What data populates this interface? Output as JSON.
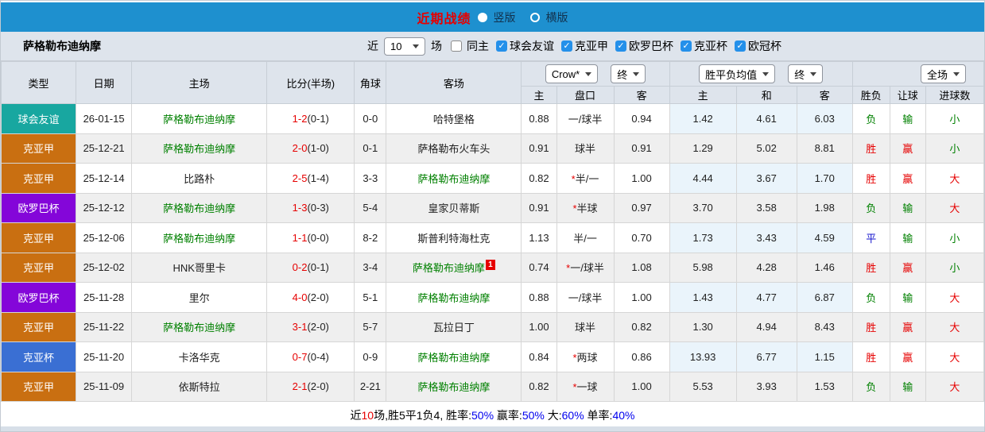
{
  "titlebar": {
    "title": "近期战绩",
    "vertical_label": "竖版",
    "vertical_selected": true,
    "horizontal_label": "横版",
    "horizontal_selected": false
  },
  "filterbar": {
    "team_name": "萨格勒布迪纳摩",
    "near_label": "近",
    "near_value": "10",
    "games_label": "场",
    "same_home_label": "同主",
    "same_home_checked": false,
    "leagues": [
      {
        "label": "球会友谊",
        "checked": true
      },
      {
        "label": "克亚甲",
        "checked": true
      },
      {
        "label": "欧罗巴杯",
        "checked": true
      },
      {
        "label": "克亚杯",
        "checked": true
      },
      {
        "label": "欧冠杯",
        "checked": true
      }
    ]
  },
  "table": {
    "columns_main": [
      "类型",
      "日期",
      "主场",
      "比分(半场)",
      "角球",
      "客场"
    ],
    "columns_sub": [
      "主",
      "盘口",
      "客",
      "主",
      "和",
      "客",
      "胜负",
      "让球",
      "进球数"
    ],
    "selects": {
      "odds_source": "Crow*",
      "odds_time": "终",
      "avg_metric": "胜平负均值",
      "avg_time": "终",
      "scope": "全场"
    },
    "rows": [
      {
        "type": "球会友谊",
        "type_color": "teal",
        "date": "26-01-15",
        "home": "萨格勒布迪纳摩",
        "home_color": "green",
        "score": "1-2",
        "half": "(0-1)",
        "corner": "0-0",
        "away": "哈特堡格",
        "away_color": "",
        "away_red_card": "",
        "odds_home": "0.88",
        "handicap_star": "",
        "handicap": "一/球半",
        "odds_away": "0.94",
        "avg_home": "1.42",
        "avg_draw": "4.61",
        "avg_away": "6.03",
        "result": "负",
        "result_color": "green",
        "handicap_result": "输",
        "handicap_result_color": "green",
        "goals": "小",
        "goals_color": "green"
      },
      {
        "type": "克亚甲",
        "type_color": "orange",
        "date": "25-12-21",
        "home": "萨格勒布迪纳摩",
        "home_color": "green",
        "score": "2-0",
        "half": "(1-0)",
        "corner": "0-1",
        "away": "萨格勒布火车头",
        "away_color": "",
        "away_red_card": "",
        "odds_home": "0.91",
        "handicap_star": "",
        "handicap": "球半",
        "odds_away": "0.91",
        "avg_home": "1.29",
        "avg_draw": "5.02",
        "avg_away": "8.81",
        "result": "胜",
        "result_color": "red",
        "handicap_result": "赢",
        "handicap_result_color": "red",
        "goals": "小",
        "goals_color": "green"
      },
      {
        "type": "克亚甲",
        "type_color": "orange",
        "date": "25-12-14",
        "home": "比路朴",
        "home_color": "",
        "score": "2-5",
        "half": "(1-4)",
        "corner": "3-3",
        "away": "萨格勒布迪纳摩",
        "away_color": "green",
        "away_red_card": "",
        "odds_home": "0.82",
        "handicap_star": "*",
        "handicap": "半/一",
        "odds_away": "1.00",
        "avg_home": "4.44",
        "avg_draw": "3.67",
        "avg_away": "1.70",
        "result": "胜",
        "result_color": "red",
        "handicap_result": "赢",
        "handicap_result_color": "red",
        "goals": "大",
        "goals_color": "red"
      },
      {
        "type": "欧罗巴杯",
        "type_color": "purple",
        "date": "25-12-12",
        "home": "萨格勒布迪纳摩",
        "home_color": "green",
        "score": "1-3",
        "half": "(0-3)",
        "corner": "5-4",
        "away": "皇家贝蒂斯",
        "away_color": "",
        "away_red_card": "",
        "odds_home": "0.91",
        "handicap_star": "*",
        "handicap": "半球",
        "odds_away": "0.97",
        "avg_home": "3.70",
        "avg_draw": "3.58",
        "avg_away": "1.98",
        "result": "负",
        "result_color": "green",
        "handicap_result": "输",
        "handicap_result_color": "green",
        "goals": "大",
        "goals_color": "red"
      },
      {
        "type": "克亚甲",
        "type_color": "orange",
        "date": "25-12-06",
        "home": "萨格勒布迪纳摩",
        "home_color": "green",
        "score": "1-1",
        "half": "(0-0)",
        "corner": "8-2",
        "away": "斯普利特海杜克",
        "away_color": "",
        "away_red_card": "",
        "odds_home": "1.13",
        "handicap_star": "",
        "handicap": "半/一",
        "odds_away": "0.70",
        "avg_home": "1.73",
        "avg_draw": "3.43",
        "avg_away": "4.59",
        "result": "平",
        "result_color": "blue",
        "handicap_result": "输",
        "handicap_result_color": "green",
        "goals": "小",
        "goals_color": "green"
      },
      {
        "type": "克亚甲",
        "type_color": "orange",
        "date": "25-12-02",
        "home": "HNK哥里卡",
        "home_color": "",
        "score": "0-2",
        "half": "(0-1)",
        "corner": "3-4",
        "away": "萨格勒布迪纳摩",
        "away_color": "green",
        "away_red_card": "1",
        "odds_home": "0.74",
        "handicap_star": "*",
        "handicap": "一/球半",
        "odds_away": "1.08",
        "avg_home": "5.98",
        "avg_draw": "4.28",
        "avg_away": "1.46",
        "result": "胜",
        "result_color": "red",
        "handicap_result": "赢",
        "handicap_result_color": "red",
        "goals": "小",
        "goals_color": "green"
      },
      {
        "type": "欧罗巴杯",
        "type_color": "purple",
        "date": "25-11-28",
        "home": "里尔",
        "home_color": "",
        "score": "4-0",
        "half": "(2-0)",
        "corner": "5-1",
        "away": "萨格勒布迪纳摩",
        "away_color": "green",
        "away_red_card": "",
        "odds_home": "0.88",
        "handicap_star": "",
        "handicap": "一/球半",
        "odds_away": "1.00",
        "avg_home": "1.43",
        "avg_draw": "4.77",
        "avg_away": "6.87",
        "result": "负",
        "result_color": "green",
        "handicap_result": "输",
        "handicap_result_color": "green",
        "goals": "大",
        "goals_color": "red"
      },
      {
        "type": "克亚甲",
        "type_color": "orange",
        "date": "25-11-22",
        "home": "萨格勒布迪纳摩",
        "home_color": "green",
        "score": "3-1",
        "half": "(2-0)",
        "corner": "5-7",
        "away": "瓦拉日丁",
        "away_color": "",
        "away_red_card": "",
        "odds_home": "1.00",
        "handicap_star": "",
        "handicap": "球半",
        "odds_away": "0.82",
        "avg_home": "1.30",
        "avg_draw": "4.94",
        "avg_away": "8.43",
        "result": "胜",
        "result_color": "red",
        "handicap_result": "赢",
        "handicap_result_color": "red",
        "goals": "大",
        "goals_color": "red"
      },
      {
        "type": "克亚杯",
        "type_color": "blue",
        "date": "25-11-20",
        "home": "卡洛华克",
        "home_color": "",
        "score": "0-7",
        "half": "(0-4)",
        "corner": "0-9",
        "away": "萨格勒布迪纳摩",
        "away_color": "green",
        "away_red_card": "",
        "odds_home": "0.84",
        "handicap_star": "*",
        "handicap": "两球",
        "odds_away": "0.86",
        "avg_home": "13.93",
        "avg_draw": "6.77",
        "avg_away": "1.15",
        "result": "胜",
        "result_color": "red",
        "handicap_result": "赢",
        "handicap_result_color": "red",
        "goals": "大",
        "goals_color": "red"
      },
      {
        "type": "克亚甲",
        "type_color": "orange",
        "date": "25-11-09",
        "home": "依斯特拉",
        "home_color": "",
        "score": "2-1",
        "half": "(2-0)",
        "corner": "2-21",
        "away": "萨格勒布迪纳摩",
        "away_color": "green",
        "away_red_card": "",
        "odds_home": "0.82",
        "handicap_star": "*",
        "handicap": "一球",
        "odds_away": "1.00",
        "avg_home": "5.53",
        "avg_draw": "3.93",
        "avg_away": "1.53",
        "result": "负",
        "result_color": "green",
        "handicap_result": "输",
        "handicap_result_color": "green",
        "goals": "大",
        "goals_color": "red"
      }
    ]
  },
  "footer": {
    "prefix": "近",
    "count": "10",
    "record": "场,胜5平1负4, 胜率:",
    "win_rate": "50%",
    "sep1": " 赢率:",
    "handicap_rate": "50%",
    "sep2": " 大:",
    "big_rate": "60%",
    "sep3": " 单率:",
    "single_rate": "40%"
  },
  "colors": {
    "titlebar_blue": "#1e90cf",
    "title_red": "#e60000",
    "panel_gray_blue": "#dee4ec",
    "badge_friendly_teal": "#18a7a0",
    "badge_league_orange": "#c96f11",
    "badge_europa_purple": "#8406d9",
    "badge_cup_blue": "#3a6fd3",
    "team_green": "#008000",
    "score_red": "#e60000",
    "draw_blue": "#1414cc",
    "rate_link_blue": "#0000ee",
    "checkbox_blue": "#2490ea",
    "avg_cell_blue": "#eaf4fb",
    "alt_row_gray": "#efefef"
  }
}
